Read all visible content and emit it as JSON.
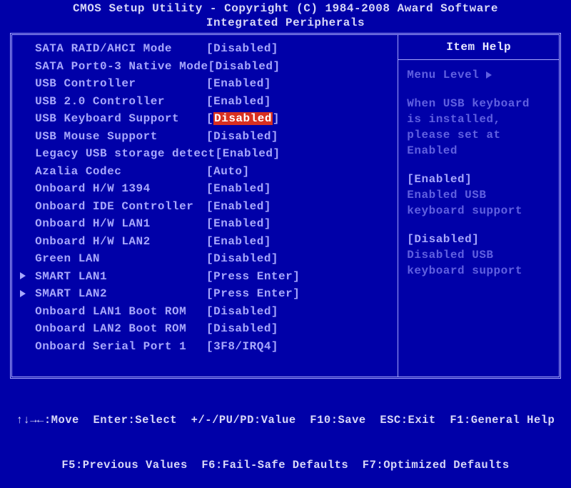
{
  "header": {
    "title": "CMOS Setup Utility - Copyright (C) 1984-2008 Award Software",
    "subtitle": "Integrated Peripherals"
  },
  "selected_index": 4,
  "items": [
    {
      "marker": "",
      "label": "SATA RAID/AHCI Mode",
      "value": "Disabled"
    },
    {
      "marker": "",
      "label": "SATA Port0-3 Native Mode",
      "value": "Disabled"
    },
    {
      "marker": "",
      "label": "USB Controller",
      "value": "Enabled"
    },
    {
      "marker": "",
      "label": "USB 2.0 Controller",
      "value": "Enabled"
    },
    {
      "marker": "",
      "label": "USB Keyboard Support",
      "value": "Disabled"
    },
    {
      "marker": "",
      "label": "USB Mouse Support",
      "value": "Disabled"
    },
    {
      "marker": "",
      "label": "Legacy USB storage detect",
      "value": "Enabled"
    },
    {
      "marker": "",
      "label": "Azalia Codec",
      "value": "Auto"
    },
    {
      "marker": "",
      "label": "Onboard H/W 1394",
      "value": "Enabled"
    },
    {
      "marker": "",
      "label": "Onboard IDE Controller",
      "value": "Enabled"
    },
    {
      "marker": "",
      "label": "Onboard H/W LAN1",
      "value": "Enabled"
    },
    {
      "marker": "",
      "label": "Onboard H/W LAN2",
      "value": "Enabled"
    },
    {
      "marker": "",
      "label": "Green LAN",
      "value": "Disabled"
    },
    {
      "marker": "▶",
      "label": "SMART LAN1",
      "value": "Press Enter"
    },
    {
      "marker": "▶",
      "label": "SMART LAN2",
      "value": "Press Enter"
    },
    {
      "marker": "",
      "label": "Onboard LAN1 Boot ROM",
      "value": "Disabled"
    },
    {
      "marker": "",
      "label": "Onboard LAN2 Boot ROM",
      "value": "Disabled"
    },
    {
      "marker": "",
      "label": "Onboard Serial Port 1",
      "value": "3F8/IRQ4"
    }
  ],
  "help": {
    "title": "Item Help",
    "menu_level": "Menu Level",
    "desc": "When USB keyboard is installed, please set at Enabled",
    "opt_enabled_label": "[Enabled]",
    "opt_enabled_desc": "Enabled USB keyboard support",
    "opt_disabled_label": "[Disabled]",
    "opt_disabled_desc": "Disabled USB keyboard support"
  },
  "footer": {
    "line1": "↑↓→←:Move  Enter:Select  +/-/PU/PD:Value  F10:Save  ESC:Exit  F1:General Help",
    "line2": "F5:Previous Values  F6:Fail-Safe Defaults  F7:Optimized Defaults"
  }
}
